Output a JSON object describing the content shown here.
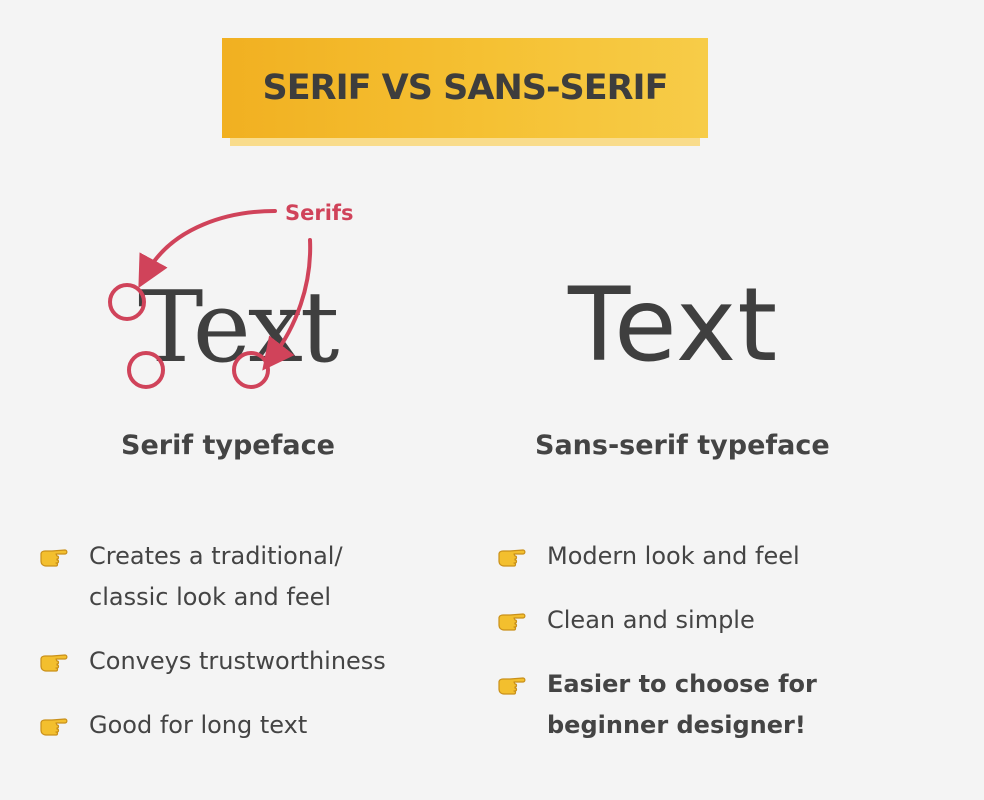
{
  "title": "SERIF VS SANS-SERIF",
  "serifs_label": "Serifs",
  "samples": {
    "serif": "Text",
    "sans": "Text"
  },
  "headings": {
    "serif": "Serif typeface",
    "sans": "Sans-serif typeface"
  },
  "serif_points": [
    {
      "lines": [
        "Creates a traditional/",
        "classic look and feel"
      ]
    },
    {
      "lines": [
        "Conveys trustworthiness"
      ]
    },
    {
      "lines": [
        "Good for long text"
      ]
    }
  ],
  "sans_points": [
    {
      "lines": [
        "Modern look and feel"
      ]
    },
    {
      "lines": [
        "Clean and simple"
      ]
    },
    {
      "lines": [
        "Easier to choose for",
        "beginner designer!"
      ]
    }
  ],
  "icons": {
    "bullet": "pointing-hand-icon",
    "annotation": "circle-marker-icon"
  },
  "colors": {
    "background": "#f4f4f4",
    "title_bar": "#f5c133",
    "title_shadow": "#f9dc8c",
    "annotation": "#d0435a",
    "text": "#444444"
  }
}
